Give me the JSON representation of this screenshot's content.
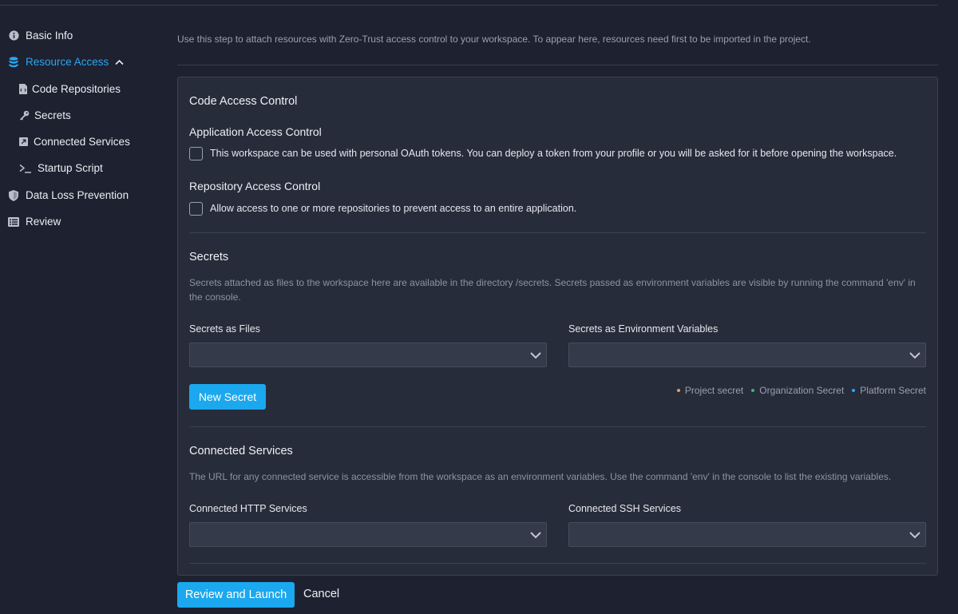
{
  "sidebar": {
    "items": [
      {
        "label": "Basic Info",
        "icon": "info-icon"
      },
      {
        "label": "Resource Access",
        "icon": "database-icon",
        "active": true
      },
      {
        "label": "Code Repositories",
        "icon": "file-code-icon"
      },
      {
        "label": "Secrets",
        "icon": "key-icon"
      },
      {
        "label": "Connected Services",
        "icon": "external-link-icon"
      },
      {
        "label": "Startup Script",
        "icon": "terminal-icon"
      },
      {
        "label": "Data Loss Prevention",
        "icon": "shield-icon"
      },
      {
        "label": "Review",
        "icon": "list-icon"
      }
    ]
  },
  "intro": "Use this step to attach resources with Zero-Trust access control to your workspace. To appear here, resources need first to be imported in the project.",
  "code_access": {
    "title": "Code Access Control",
    "application": {
      "title": "Application Access Control",
      "checkbox_label": "This workspace can be used with personal OAuth tokens. You can deploy a token from your profile or you will be asked for it before opening the workspace."
    },
    "repository": {
      "title": "Repository Access Control",
      "checkbox_label": "Allow access to one or more repositories to prevent access to an entire application."
    }
  },
  "secrets": {
    "title": "Secrets",
    "description": "Secrets attached as files to the workspace here are available in the directory /secrets. Secrets passed as environment variables are visible by running the command 'env' in the console.",
    "files_label": "Secrets as Files",
    "env_label": "Secrets as Environment Variables",
    "new_button": "New Secret",
    "legend": [
      {
        "label": "Project secret",
        "color": "#e8a33a"
      },
      {
        "label": "Organization Secret",
        "color": "#3fb57a"
      },
      {
        "label": "Platform Secret",
        "color": "#2aa6f0"
      }
    ]
  },
  "connected": {
    "title": "Connected Services",
    "description": "The URL for any connected service is accessible from the workspace as an environment variables. Use the command 'env' in the console to list the existing variables.",
    "http_label": "Connected HTTP Services",
    "ssh_label": "Connected SSH Services"
  },
  "footer": {
    "review_button": "Review and Launch",
    "cancel_button": "Cancel"
  },
  "colors": {
    "accent": "#1ba8ee",
    "background": "#1d2130",
    "panel": "#272c3b"
  }
}
